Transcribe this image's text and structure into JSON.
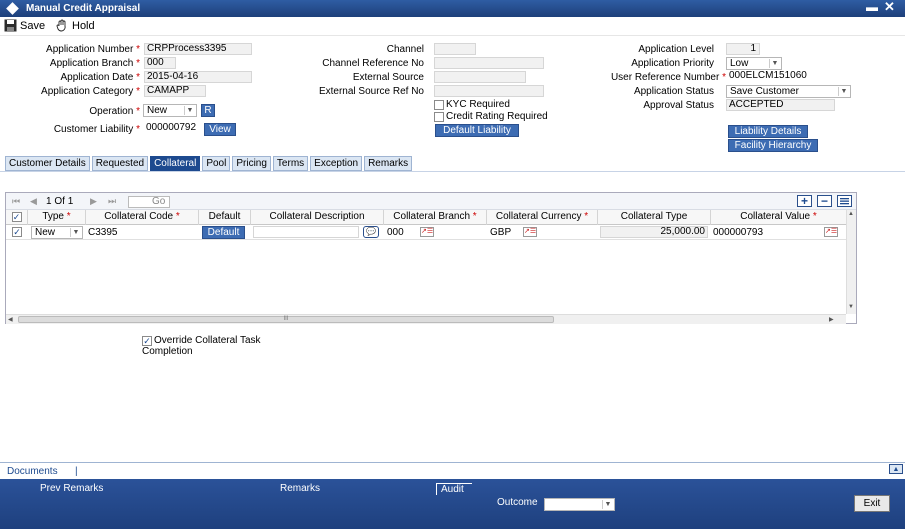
{
  "window": {
    "title": "Manual Credit Appraisal",
    "minimize_glyph": "▬",
    "close_glyph": "✕"
  },
  "toolbar": {
    "save_label": "Save",
    "hold_label": "Hold"
  },
  "form": {
    "application_number_label": "Application Number",
    "application_number": "CRPProcess3395",
    "application_branch_label": "Application Branch",
    "application_branch": "000",
    "application_date_label": "Application Date",
    "application_date": "2015-04-16",
    "application_category_label": "Application Category",
    "application_category": "CAMAPP",
    "operation_label": "Operation",
    "operation_value": "New",
    "operation_button": "R",
    "customer_liability_label": "Customer Liability",
    "customer_liability": "000000792",
    "view_button": "View",
    "channel_label": "Channel",
    "channel_value": "",
    "channel_ref_label": "Channel Reference No",
    "channel_ref_value": "",
    "external_source_label": "External Source",
    "external_source_value": "",
    "external_source_ref_label": "External Source Ref No",
    "external_source_ref_value": "",
    "kyc_label": "KYC Required",
    "credit_rating_label": "Credit Rating Required",
    "default_liability_button": "Default Liability",
    "application_level_label": "Application Level",
    "application_level": "1",
    "application_priority_label": "Application Priority",
    "application_priority": "Low",
    "user_ref_label": "User Reference Number",
    "user_ref_value": "000ELCM151060",
    "application_status_label": "Application Status",
    "application_status": "Save Customer",
    "approval_status_label": "Approval Status",
    "approval_status": "ACCEPTED",
    "liability_details_button": "Liability Details",
    "facility_hierarchy_button": "Facility Hierarchy",
    "required_marker": "*"
  },
  "tabs": [
    {
      "label": "Customer Details"
    },
    {
      "label": "Requested"
    },
    {
      "label": "Collateral"
    },
    {
      "label": "Pool"
    },
    {
      "label": "Pricing"
    },
    {
      "label": "Terms"
    },
    {
      "label": "Exception"
    },
    {
      "label": "Remarks"
    }
  ],
  "grid": {
    "pager": {
      "current": "1",
      "of_label": "Of",
      "total": "1",
      "go_label": "Go"
    },
    "columns": {
      "type": "Type",
      "collateral_code": "Collateral Code",
      "default": "Default",
      "collateral_description": "Collateral Description",
      "collateral_branch": "Collateral Branch",
      "collateral_currency": "Collateral Currency",
      "collateral_type": "Collateral Type",
      "collateral_value": "Collateral Value"
    },
    "row": {
      "type": "New",
      "collateral_code": "C3395",
      "default_button": "Default",
      "collateral_description": "",
      "collateral_branch": "000",
      "collateral_currency": "GBP",
      "collateral_type": "25,000.00",
      "collateral_value": "000000793"
    },
    "scroll_grip": "III"
  },
  "override": {
    "label_line1": "Override Collateral Task",
    "label_line2": "Completion"
  },
  "footer": {
    "documents_label": "Documents",
    "separator": "|",
    "prev_remarks_label": "Prev Remarks",
    "remarks_label": "Remarks",
    "audit_label": "Audit",
    "outcome_label": "Outcome",
    "outcome_value": "",
    "exit_label": "Exit"
  }
}
